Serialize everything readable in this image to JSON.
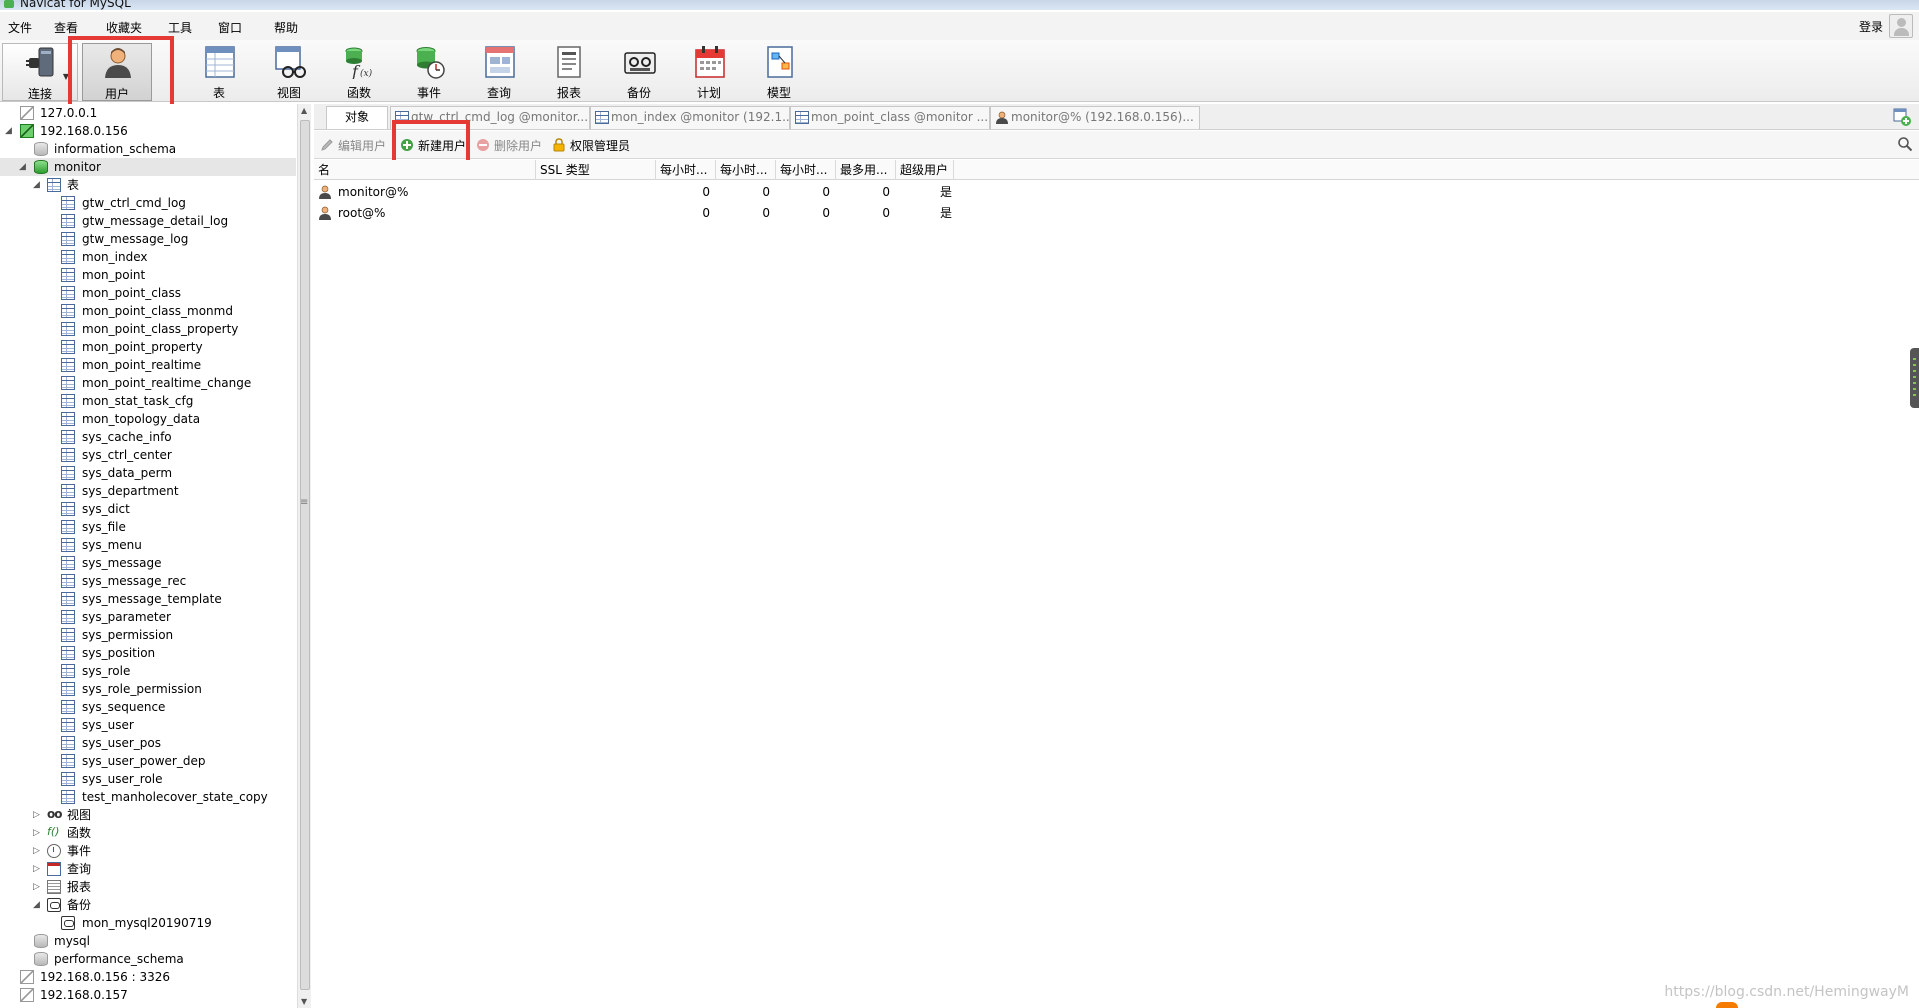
{
  "window": {
    "title": "Navicat for MySQL"
  },
  "menu": {
    "items": [
      "文件",
      "查看",
      "收藏夹",
      "工具",
      "窗口",
      "帮助"
    ],
    "login": "登录"
  },
  "toolbar": {
    "buttons": [
      {
        "label": "连接",
        "icon": "plug-icon"
      },
      {
        "label": "用户",
        "icon": "user-icon"
      },
      {
        "label": "表",
        "icon": "table-icon"
      },
      {
        "label": "视图",
        "icon": "view-icon"
      },
      {
        "label": "函数",
        "icon": "function-icon"
      },
      {
        "label": "事件",
        "icon": "event-icon"
      },
      {
        "label": "查询",
        "icon": "query-icon"
      },
      {
        "label": "报表",
        "icon": "report-icon"
      },
      {
        "label": "备份",
        "icon": "backup-icon"
      },
      {
        "label": "计划",
        "icon": "schedule-icon"
      },
      {
        "label": "模型",
        "icon": "model-icon"
      }
    ]
  },
  "tree": {
    "conn1": "127.0.0.1",
    "conn2": "192.168.0.156",
    "db_info": "information_schema",
    "db_monitor": "monitor",
    "tables_label": "表",
    "tables": [
      "gtw_ctrl_cmd_log",
      "gtw_message_detail_log",
      "gtw_message_log",
      "mon_index",
      "mon_point",
      "mon_point_class",
      "mon_point_class_monmd",
      "mon_point_class_property",
      "mon_point_property",
      "mon_point_realtime",
      "mon_point_realtime_change",
      "mon_stat_task_cfg",
      "mon_topology_data",
      "sys_cache_info",
      "sys_ctrl_center",
      "sys_data_perm",
      "sys_department",
      "sys_dict",
      "sys_file",
      "sys_menu",
      "sys_message",
      "sys_message_rec",
      "sys_message_template",
      "sys_parameter",
      "sys_permission",
      "sys_position",
      "sys_role",
      "sys_role_permission",
      "sys_sequence",
      "sys_user",
      "sys_user_pos",
      "sys_user_power_dep",
      "sys_user_role",
      "test_manholecover_state_copy"
    ],
    "views_label": "视图",
    "functions_label": "函数",
    "events_label": "事件",
    "queries_label": "查询",
    "reports_label": "报表",
    "backups_label": "备份",
    "backup_item": "mon_mysql20190719",
    "db_mysql": "mysql",
    "db_perf": "performance_schema",
    "conn3": "192.168.0.156 : 3326",
    "conn4": "192.168.0.157"
  },
  "tabs": {
    "object": "对象",
    "items": [
      "gtw_ctrl_cmd_log @monitor...",
      "mon_index @monitor (192.1...",
      "mon_point_class @monitor ...",
      "monitor@% (192.168.0.156)..."
    ]
  },
  "object_toolbar": {
    "edit_user": "编辑用户",
    "new_user": "新建用户",
    "delete_user": "删除用户",
    "privilege_manager": "权限管理员"
  },
  "grid": {
    "headers": [
      "名",
      "SSL 类型",
      "每小时...",
      "每小时...",
      "每小时...",
      "最多用...",
      "超级用户"
    ],
    "rows": [
      {
        "name": "monitor@%",
        "ssl": "",
        "q": "0",
        "u": "0",
        "c": "0",
        "m": "0",
        "super": "是"
      },
      {
        "name": "root@%",
        "ssl": "",
        "q": "0",
        "u": "0",
        "c": "0",
        "m": "0",
        "super": "是"
      }
    ]
  },
  "watermark": "https://blog.csdn.net/HemingwayM"
}
